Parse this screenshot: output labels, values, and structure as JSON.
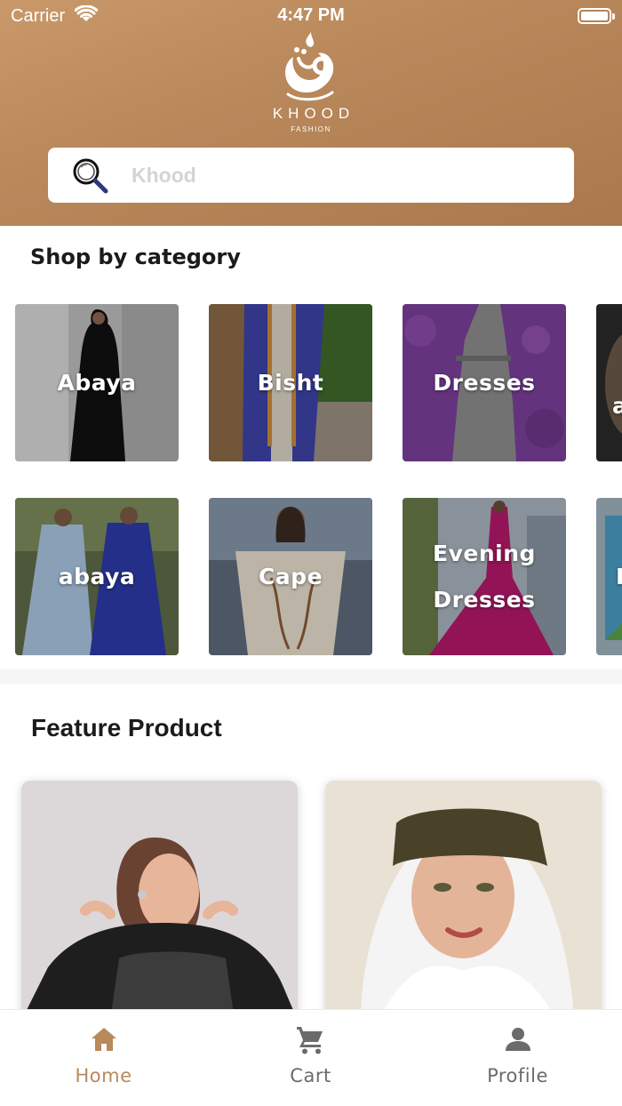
{
  "status_bar": {
    "carrier": "Carrier",
    "time": "4:47 PM",
    "battery_level": 1.0
  },
  "brand": {
    "name": "KHOOD",
    "tagline": "FASHION"
  },
  "search": {
    "placeholder": "Khood",
    "value": ""
  },
  "categories": {
    "title": "Shop by category",
    "items": [
      {
        "label": "Abaya"
      },
      {
        "label": "Bisht"
      },
      {
        "label": "Dresses"
      },
      {
        "label": "a"
      },
      {
        "label": "abaya"
      },
      {
        "label": "Cape"
      },
      {
        "label": "Evening",
        "label2": "Dresses"
      },
      {
        "label": "H"
      }
    ]
  },
  "featured": {
    "title": "Feature Product",
    "products": [
      {
        "image": "woman-black-sheer-top"
      },
      {
        "image": "woman-white-hijab"
      }
    ]
  },
  "tabbar": {
    "items": [
      {
        "label": "Home",
        "icon": "home-icon",
        "active": true
      },
      {
        "label": "Cart",
        "icon": "cart-icon",
        "active": false
      },
      {
        "label": "Profile",
        "icon": "profile-icon",
        "active": false
      }
    ]
  },
  "colors": {
    "accent": "#b8895b",
    "inactive": "#6b6b6b",
    "header_start": "#c9996a",
    "header_end": "#a9784c"
  }
}
